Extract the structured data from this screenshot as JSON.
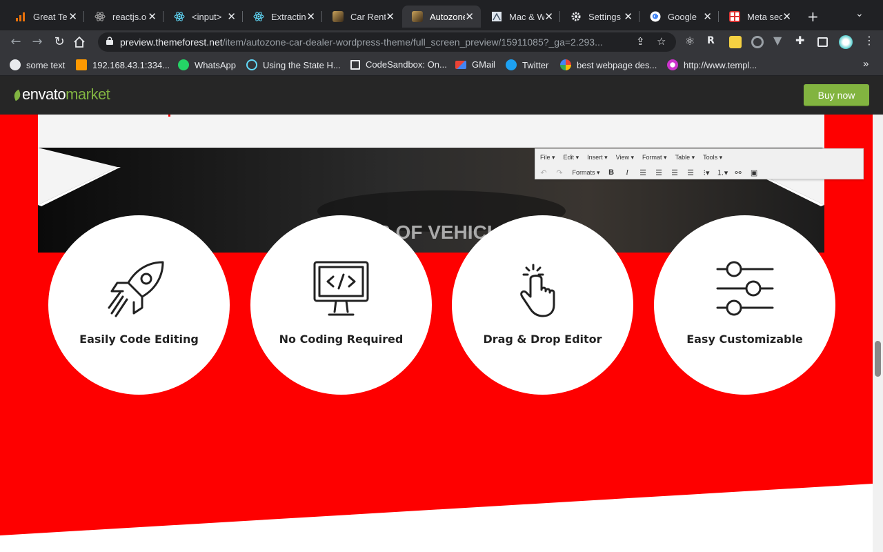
{
  "browser": {
    "tabs": [
      {
        "label": "Great Te",
        "active": false,
        "favicon": "chart-favicon",
        "color": "#e8710a"
      },
      {
        "label": "reactjs.o",
        "active": false,
        "favicon": "react-favicon",
        "color": "#61dafb"
      },
      {
        "label": "<input>",
        "active": false,
        "favicon": "react-favicon",
        "color": "#61dafb"
      },
      {
        "label": "Extractin",
        "active": false,
        "favicon": "react-favicon",
        "color": "#61dafb"
      },
      {
        "label": "Car Rent",
        "active": false,
        "favicon": "autozone-favicon",
        "color": "#8a6a3a"
      },
      {
        "label": "Autozone",
        "active": true,
        "favicon": "autozone-favicon",
        "color": "#8a6a3a"
      },
      {
        "label": "Mac & W",
        "active": false,
        "favicon": "mac-favicon",
        "color": "#9ab"
      },
      {
        "label": "Settings",
        "active": false,
        "favicon": "gear-favicon",
        "color": "#e8eaed"
      },
      {
        "label": "Google",
        "active": false,
        "favicon": "google-favicon",
        "color": "#4285f4"
      },
      {
        "label": "Meta sec",
        "active": false,
        "favicon": "meta-favicon",
        "color": "#d33"
      }
    ],
    "new_tab": "+",
    "tab_menu": "⌄",
    "url_host": "preview.themeforest.net",
    "url_path": "/item/autozone-car-dealer-wordpress-theme/full_screen_preview/15911085?_ga=2.293...",
    "bookmarks": [
      {
        "label": "some text",
        "icon": "globe-icon",
        "color": "#e8eaed"
      },
      {
        "label": "192.168.43.1:334...",
        "icon": "xampp-icon",
        "color": "#f90"
      },
      {
        "label": "WhatsApp",
        "icon": "whatsapp-icon",
        "color": "#25d366"
      },
      {
        "label": "Using the State H...",
        "icon": "react-icon",
        "color": "#61dafb"
      },
      {
        "label": "CodeSandbox: On...",
        "icon": "codesandbox-icon",
        "color": "#202124"
      },
      {
        "label": "GMail",
        "icon": "gmail-icon",
        "color": "#ea4335"
      },
      {
        "label": "Twitter",
        "icon": "twitter-icon",
        "color": "#1da1f2"
      },
      {
        "label": "best webpage des...",
        "icon": "google-icon",
        "color": "#4285f4"
      },
      {
        "label": "http://www.templ...",
        "icon": "template-icon",
        "color": "#c3c"
      }
    ],
    "bookmarks_overflow": "»"
  },
  "envato": {
    "logo_text_1": "envato",
    "logo_text_2": "market",
    "buy_label": "Buy now",
    "accent": "#82b440"
  },
  "editor": {
    "menus": [
      "File",
      "Edit",
      "Insert",
      "View",
      "Format",
      "Table",
      "Tools"
    ],
    "formats_label": "Formats"
  },
  "hero": {
    "heading": "S OF VEHICL"
  },
  "features": [
    {
      "title": "Easily Code Editing",
      "icon": "rocket-icon"
    },
    {
      "title": "No Coding Required",
      "icon": "code-monitor-icon"
    },
    {
      "title": "Drag & Drop Editor",
      "icon": "hand-pointer-icon"
    },
    {
      "title": "Easy Customizable",
      "icon": "sliders-icon"
    }
  ],
  "colors": {
    "page_red": "#fe0000",
    "chrome_dark": "#202124",
    "chrome_toolbar": "#35363a"
  }
}
